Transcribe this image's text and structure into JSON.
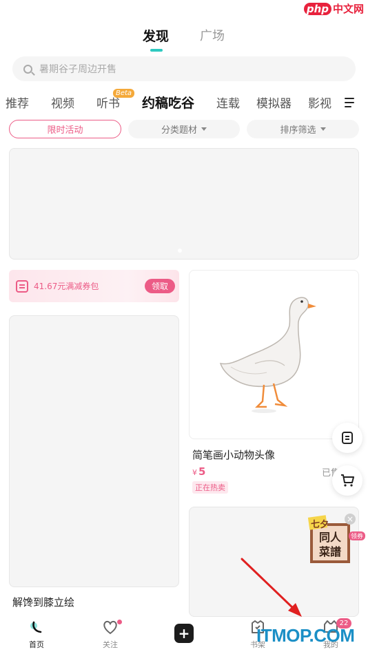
{
  "watermark_top": {
    "badge": "php",
    "text": "中文网"
  },
  "watermark_bottom": {
    "text": "ITMOP.COM"
  },
  "top_tabs": [
    {
      "label": "发现",
      "active": true
    },
    {
      "label": "广场",
      "active": false
    }
  ],
  "search": {
    "placeholder": "暑期谷子周边开售"
  },
  "category_tabs": [
    "推荐",
    "视频",
    "听书",
    "约稿吃谷",
    "连载",
    "模拟器",
    "影视"
  ],
  "category_active": "约稿吃谷",
  "beta_label": "Beta",
  "filters": [
    {
      "label": "限时活动",
      "active": true
    },
    {
      "label": "分类题材",
      "active": false
    },
    {
      "label": "排序筛选",
      "active": false
    }
  ],
  "coupon": {
    "text": "41.67元满减券包",
    "button": "领取"
  },
  "left_card": {
    "title": "解馋到膝立绘"
  },
  "right_card": {
    "title": "简笔画小动物头像",
    "currency": "¥",
    "price": "5",
    "sold": "已售",
    "tag": "正在热卖"
  },
  "promo": {
    "line1": "同人",
    "line2": "菜譜",
    "corner": "七夕",
    "tag": "领券",
    "close": "×"
  },
  "bottom_nav": [
    {
      "label": "首页",
      "active": true
    },
    {
      "label": "关注",
      "active": false
    },
    {
      "label": "",
      "active": false
    },
    {
      "label": "书架",
      "active": false
    },
    {
      "label": "我的",
      "active": false
    }
  ],
  "nav_badge_count": "22",
  "colors": {
    "accent_teal": "#2ec9c0",
    "accent_pink": "#ec5b86",
    "arrow_red": "#e02020"
  }
}
